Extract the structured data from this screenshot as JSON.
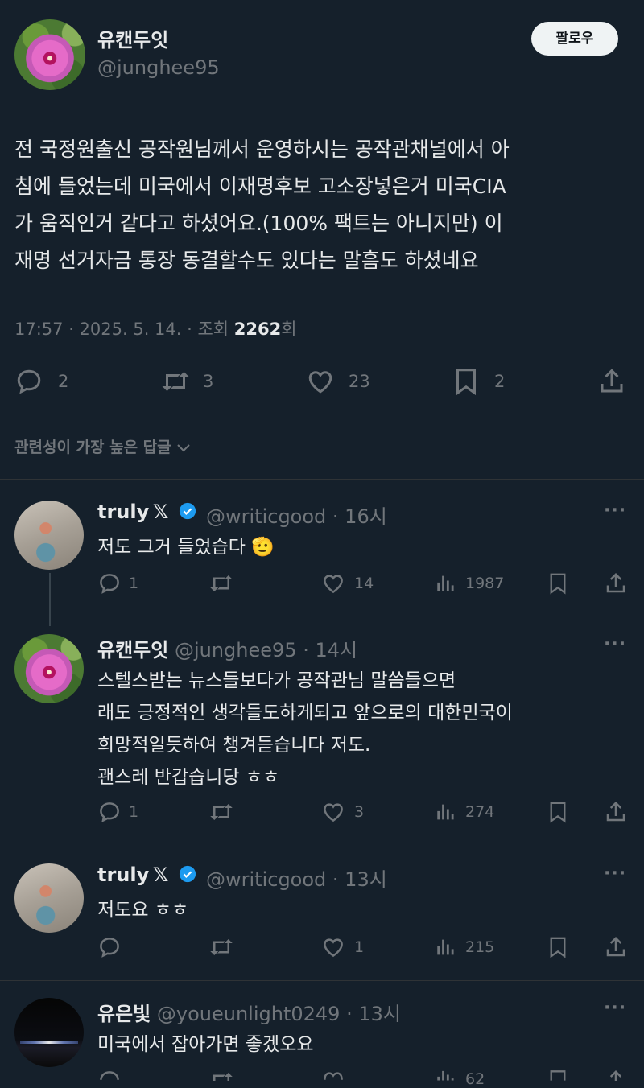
{
  "main_post": {
    "author_name": "유캔두잇",
    "author_handle": "@junghee95",
    "follow_label": "팔로우",
    "lines": [
      "전 국정원출신 공작원님께서 운영하시는 공작관채널에서 아",
      "침에 들었는데 미국에서 이재명후보 고소장넣은거 미국CIA",
      "가 움직인거 같다고 하셨어요.(100% 팩트는 아니지만) 이",
      "재명 선거자금 통장 동결할수도 있다는 말흠도 하셨네요"
    ],
    "meta_prefix": "17:57 · 2025. 5. 14. · 조회 ",
    "views": "2262",
    "views_suffix": "회",
    "replies": "2",
    "reposts": "3",
    "likes": "23",
    "bookmarks": "2"
  },
  "sort_label": "관련성이 가장 높은 답글",
  "replies": [
    {
      "name": "truly",
      "x_mark": "𝕏",
      "handle": "@writicgood",
      "time": "· 16시",
      "lines": [
        "저도 그거 들었습다 🫡"
      ],
      "replies": "1",
      "reposts": "",
      "likes": "14",
      "views": "1987"
    },
    {
      "name": "유캔두잇",
      "handle": "@junghee95",
      "time": "· 14시",
      "lines": [
        "스텔스받는 뉴스들보다가 공작관님 말씀들으면",
        "래도 긍정적인 생각들도하게되고 앞으로의 대한민국이",
        "희망적일듯하여 챙겨듣습니다 저도.",
        "괜스레 반갑습니당 ㅎㅎ"
      ],
      "replies": "1",
      "reposts": "",
      "likes": "3",
      "views": "274"
    },
    {
      "name": "truly",
      "x_mark": "𝕏",
      "handle": "@writicgood",
      "time": "· 13시",
      "lines": [
        "저도요 ㅎㅎ"
      ],
      "replies": "",
      "reposts": "",
      "likes": "1",
      "views": "215"
    },
    {
      "name": "유은빛",
      "handle": "@youeunlight0249",
      "time": "· 13시",
      "lines": [
        "미국에서 잡아가면 좋겠오요"
      ],
      "replies": "",
      "reposts": "",
      "likes": "",
      "views": "62"
    }
  ],
  "more_label": "···",
  "colors": {
    "background": "#15202b",
    "muted": "#71767b",
    "verified": "#1d9bf0"
  }
}
